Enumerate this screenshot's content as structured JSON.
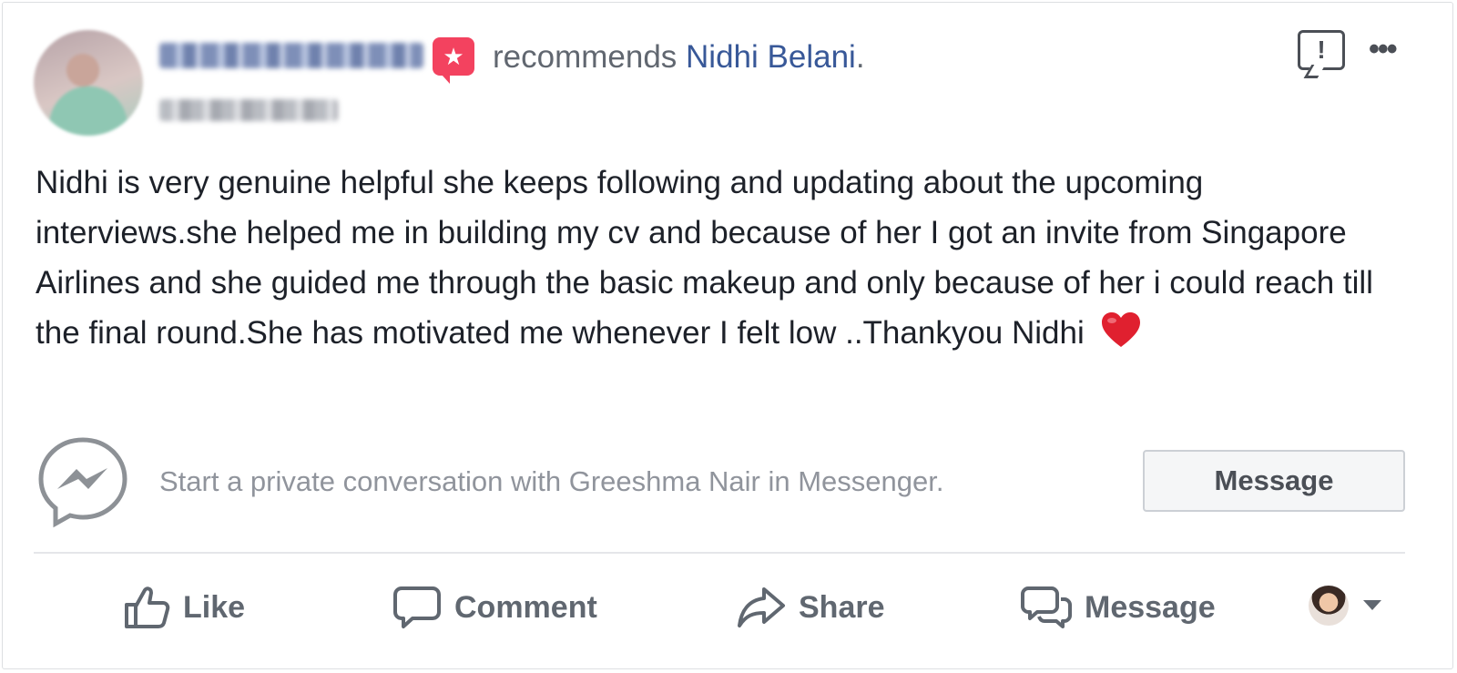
{
  "post": {
    "verb": "recommends",
    "page_name": "Nidhi Belani",
    "period": ".",
    "text": "Nidhi is very genuine helpful she keeps following and updating about the upcoming interviews.she helped me in building my cv and because of her I got an invite from Singapore Airlines and she guided me through the basic makeup and only because of her i could reach till the final round.She has motivated me whenever I felt low ..Thankyou Nidhi"
  },
  "messenger": {
    "prompt": "Start a private conversation with Greeshma Nair in Messenger.",
    "button_label": "Message"
  },
  "actions": {
    "like": "Like",
    "comment": "Comment",
    "share": "Share",
    "message": "Message"
  },
  "colors": {
    "link": "#385898",
    "recommend_badge": "#f3425f",
    "muted_text": "#90949c",
    "action_text": "#606770"
  },
  "icons": {
    "recommend": "recommend-star-icon",
    "report": "report-icon",
    "more": "more-options-icon",
    "messenger": "messenger-icon",
    "like": "thumbs-up-icon",
    "comment": "comment-bubble-icon",
    "share": "share-arrow-icon",
    "message": "message-bubbles-icon",
    "heart": "heart-emoji-icon"
  }
}
